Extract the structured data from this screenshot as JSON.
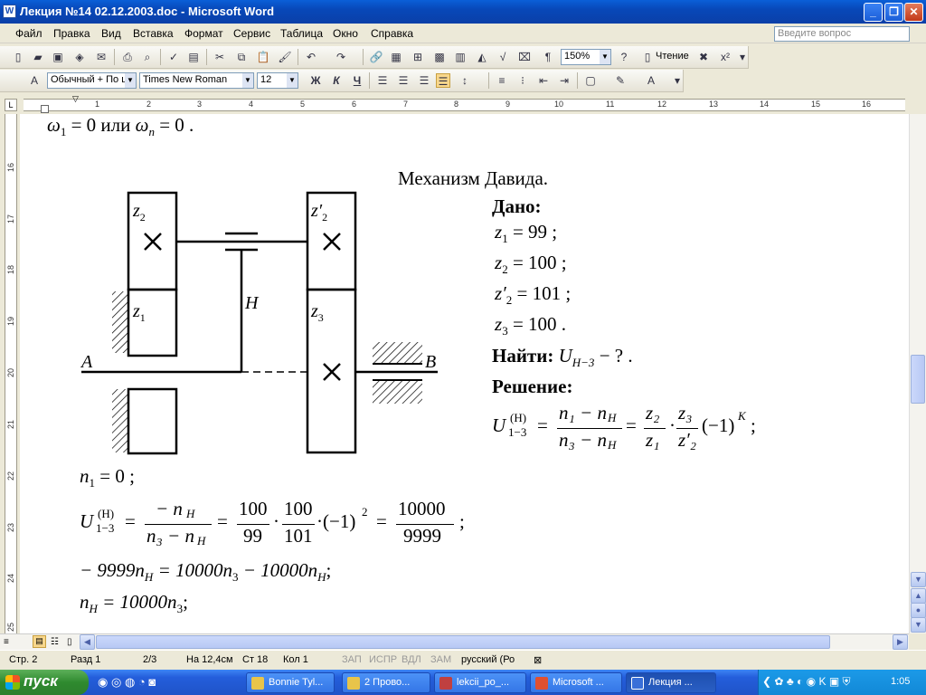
{
  "window": {
    "title": "Лекция №14 02.12.2003.doc - Microsoft Word",
    "app_icon": "W"
  },
  "menu": [
    "Файл",
    "Правка",
    "Вид",
    "Вставка",
    "Формат",
    "Сервис",
    "Таблица",
    "Окно",
    "Справка"
  ],
  "help_box": {
    "placeholder": "Введите вопрос"
  },
  "toolbar": {
    "zoom": "150%",
    "read_label": "Чтение"
  },
  "format_bar": {
    "style": "Обычный + По ц",
    "font": "Times New Roman",
    "size": "12",
    "bold": "Ж",
    "italic": "К",
    "underline": "Ч"
  },
  "ruler": {
    "h_numbers": [
      "1",
      "2",
      "3",
      "4",
      "5",
      "6",
      "7",
      "8",
      "9",
      "10",
      "11",
      "12",
      "13",
      "14",
      "15",
      "16"
    ],
    "v_numbers": [
      "16",
      "17",
      "18",
      "19",
      "20",
      "21",
      "22",
      "23",
      "24",
      "25"
    ]
  },
  "doc": {
    "top_line": {
      "w1": "ω",
      "sub1": "1",
      "eq": "= 0",
      "or": "или",
      "wn": "ω",
      "subn": "n",
      "eq2": "= 0 ."
    },
    "heading": "Механизм Давида.",
    "labels": {
      "z2": "z",
      "z2s": "2",
      "z2p": "z′",
      "z2ps": "2",
      "z1": "z",
      "z1s": "1",
      "z3": "z",
      "z3s": "3",
      "H": "H",
      "A": "A",
      "B": "B"
    },
    "given": {
      "title": "Дано:",
      "l1": "z",
      "l1s": "1",
      "l1v": "= 99 ;",
      "l2": "z",
      "l2s": "2",
      "l2v": "= 100 ;",
      "l3": "z′",
      "l3s": "2",
      "l3v": "= 101 ;",
      "l4": "z",
      "l4s": "3",
      "l4v": "= 100 ."
    },
    "find": {
      "title": "Найти:",
      "expr": "U",
      "sub": "H−3",
      "tail": "− ? ."
    },
    "solution": {
      "title": "Решение:",
      "lhs": "U",
      "sup": "(H)",
      "sub": "1−3",
      "num": "n₁ − n",
      "numsub": "H",
      "den": "n₃ − n",
      "densub": "H",
      "f2num": "z₂",
      "f2den": "z₁",
      "f3num": "z₃",
      "f3den": "z′₂",
      "tail": "(−1)",
      "tailsup": "K",
      "end": ";"
    },
    "eq1": {
      "n": "n",
      "sub": "1",
      "rest": "= 0 ;"
    },
    "eq2": {
      "lhs": "U",
      "sup": "(H)",
      "sub": "1−3",
      "num": "− n",
      "numsub": "H",
      "den": "n₃ − n",
      "densub": "H",
      "a_num": "100",
      "a_den": "99",
      "b_num": "100",
      "b_den": "101",
      "pow": "·(−1)",
      "powsup": "2",
      "c_num": "10000",
      "c_den": "9999",
      "end": ";"
    },
    "eq3": "− 9999n_H = 10000n₃ − 10000n_H ;",
    "eq3_parts": {
      "a": "− 9999n",
      "as": "H",
      "b": "= 10000n",
      "bs": "3",
      "c": "− 10000n",
      "cs": "H",
      "d": ";"
    },
    "eq4_parts": {
      "a": "n",
      "as": "H",
      "b": "= 10000n",
      "bs": "3",
      "c": ";"
    }
  },
  "status": {
    "page": "Стр. 2",
    "section": "Разд 1",
    "pages": "2/3",
    "at": "На 12,4см",
    "line": "Ст 18",
    "col": "Кол 1",
    "rec": "ЗАП",
    "trk": "ИСПР",
    "ext": "ВДЛ",
    "ovr": "ЗАМ",
    "lang": "русский (Ро"
  },
  "taskbar": {
    "start": "пуск",
    "tasks": [
      "Bonnie Tyl...",
      "2 Прово...",
      "lekcii_po_...",
      "Microsoft ...",
      "Лекция ..."
    ],
    "clock": "1:05"
  }
}
